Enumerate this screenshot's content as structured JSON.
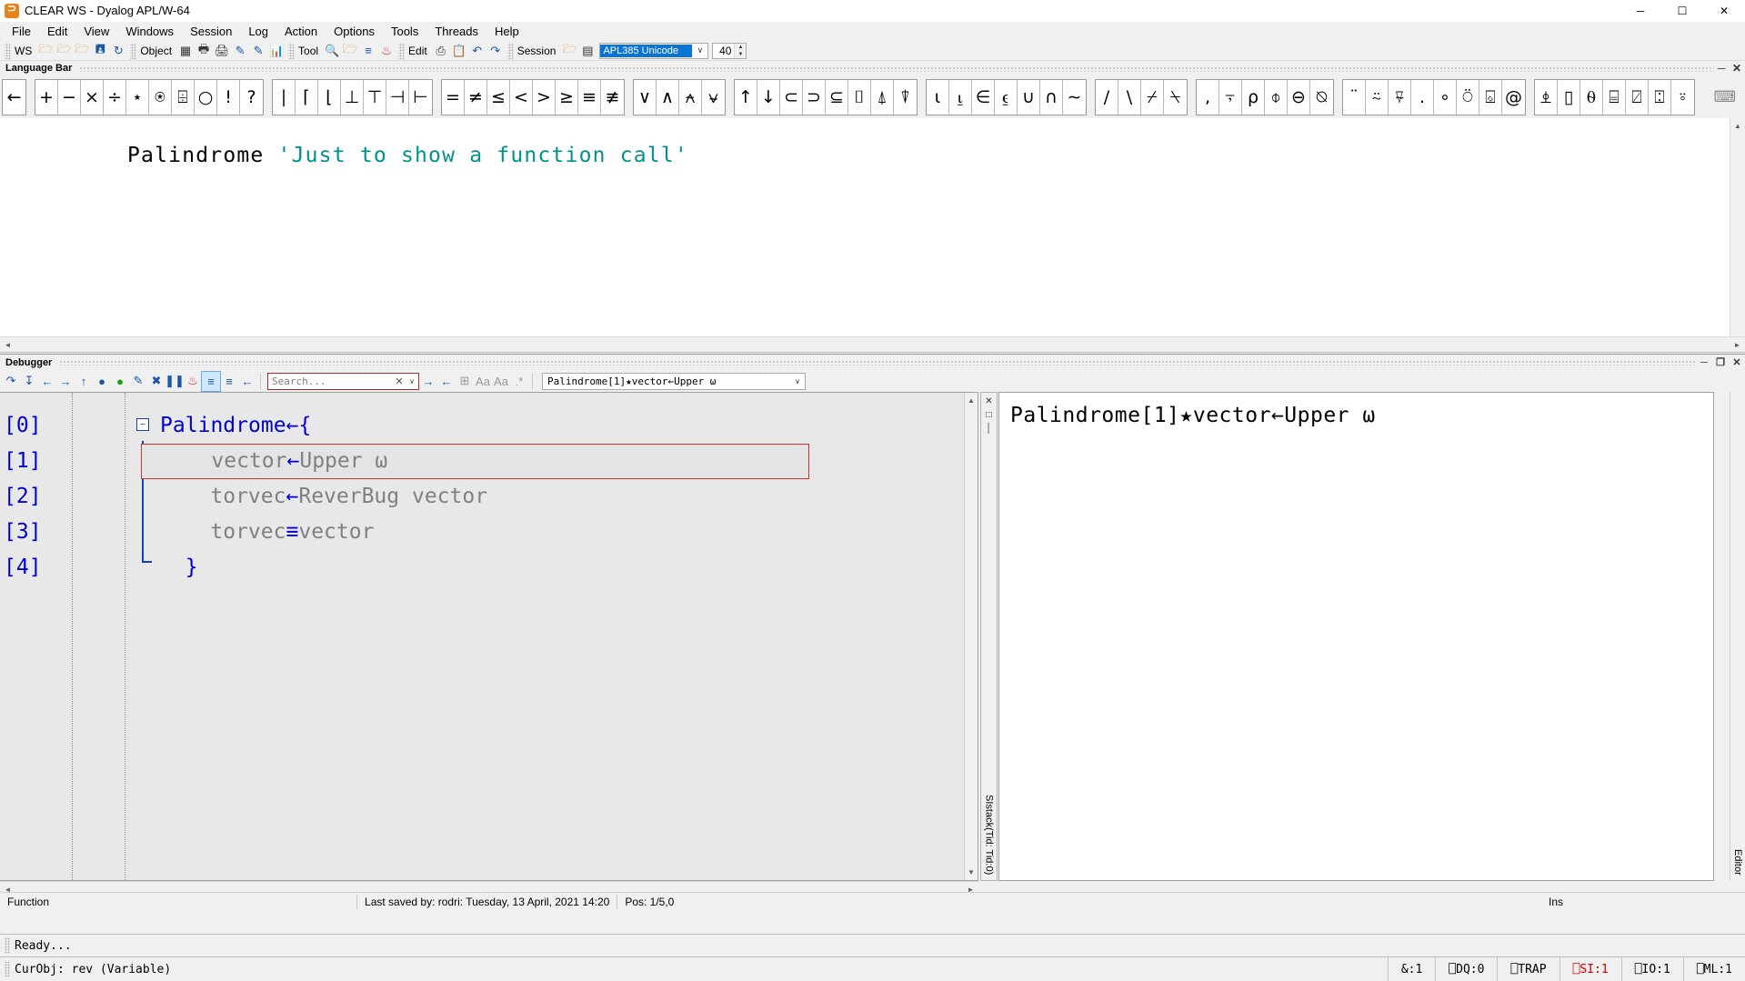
{
  "window": {
    "title": "CLEAR WS - Dyalog APL/W-64",
    "app_icon": "dyalog-logo-icon",
    "minimize": "─",
    "maximize": "☐",
    "close": "✕"
  },
  "menubar": {
    "items": [
      {
        "label": "File"
      },
      {
        "label": "Edit"
      },
      {
        "label": "View"
      },
      {
        "label": "Windows"
      },
      {
        "label": "Session"
      },
      {
        "label": "Log"
      },
      {
        "label": "Action"
      },
      {
        "label": "Options"
      },
      {
        "label": "Tools"
      },
      {
        "label": "Threads"
      },
      {
        "label": "Help"
      }
    ]
  },
  "toolbar": {
    "ws_label": "WS",
    "ws_icons": [
      "new-ws-icon",
      "open-ws-icon",
      "copy-ws-icon",
      "save-ws-icon",
      "refresh-ws-icon"
    ],
    "object_label": "Object",
    "object_icons": [
      "grid-icon",
      "print-preview-icon",
      "print-icon",
      "edit-object-icon",
      "new-object-icon",
      "chart-icon"
    ],
    "tool_label": "Tool",
    "tool_icons": [
      "search-icon",
      "explorer-icon",
      "list-icon",
      "user-command-icon"
    ],
    "edit_label": "Edit",
    "edit_icons": [
      "copy-icon",
      "paste-icon",
      "undo-icon",
      "redo-icon"
    ],
    "session_label": "Session",
    "session_icons": [
      "folder-icon",
      "line-numbers-icon"
    ],
    "font_name": "APL385 Unicode",
    "font_size": "40",
    "dropdown_arrow": "∨"
  },
  "language_bar": {
    "title": "Language Bar",
    "minimize_icon": "─",
    "close_icon": "✕",
    "keyboard_icon": "keyboard-icon",
    "groups": [
      {
        "keys": [
          "←"
        ]
      },
      {
        "keys": [
          "+",
          "−",
          "×",
          "÷",
          "⋆",
          "⍟",
          "⌹",
          "○",
          "!",
          "?"
        ]
      },
      {
        "keys": [
          "∣",
          "⌈",
          "⌊",
          "⊥",
          "⊤",
          "⊣",
          "⊢"
        ]
      },
      {
        "keys": [
          "=",
          "≠",
          "≤",
          "<",
          ">",
          "≥",
          "≡",
          "≢"
        ]
      },
      {
        "keys": [
          "∨",
          "∧",
          "⍲",
          "⍱"
        ]
      },
      {
        "keys": [
          "↑",
          "↓",
          "⊂",
          "⊃",
          "⊆",
          "⌷",
          "⍋",
          "⍒"
        ]
      },
      {
        "keys": [
          "⍳",
          "⍸",
          "∈",
          "⍷",
          "∪",
          "∩",
          "∼"
        ]
      },
      {
        "keys": [
          "/",
          "\\",
          "⌿",
          "⍀"
        ]
      },
      {
        "keys": [
          ",",
          "⍪",
          "⍴",
          "⌽",
          "⊖",
          "⍉"
        ]
      },
      {
        "keys": [
          "¨",
          "⍨",
          "⍫",
          ".",
          "∘",
          "⍥",
          "⌺",
          "@"
        ]
      },
      {
        "keys": [
          "⍎",
          "▯",
          "⍬",
          "⌸",
          "⍁",
          "⍠",
          "⍤"
        ]
      }
    ]
  },
  "session": {
    "function_call": "Palindrome ",
    "string_arg": "'Just to show a function call'",
    "scroll_up": "▲",
    "scroll_down": "▼",
    "scroll_left": "◄",
    "scroll_right": "►"
  },
  "debugger": {
    "title": "Debugger",
    "minimize_icon": "─",
    "restore_icon": "❐",
    "close_icon": "✕",
    "toolbar_icons": [
      "step-into-icon",
      "step-over-icon",
      "back-icon",
      "forward-icon",
      "step-out-icon",
      "run-to-cursor-icon",
      "continue-icon",
      "clear-trace-icon",
      "stop-icon",
      "pause-icon",
      "clear-breakpoints-icon",
      "line-numbers-icon",
      "outline-icon",
      "return-icon"
    ],
    "search": {
      "placeholder": "Search...",
      "clear_icon": "✕",
      "dropdown_icon": "∨"
    },
    "find_icons": [
      "find-next-icon",
      "find-prev-icon",
      "expand-icon",
      "match-case-icon",
      "whole-word-icon",
      "regex-icon"
    ],
    "match_case_label": "Aa",
    "whole_word_label": "Aa",
    "regex_label": ".*",
    "stack_combo_value": "Palindrome[1]★vector←Upper ω",
    "stack_dropdown_icon": "∨",
    "sistack_label": "SIstack(Tid: Tid:0)",
    "editor_tab_label": "Editor",
    "code": {
      "line_numbers": [
        "[0]",
        "[1]",
        "[2]",
        "[3]",
        "[4]"
      ],
      "fold_icon": "−",
      "lines": [
        {
          "text": "Palindrome←{",
          "highlighted": false
        },
        {
          "text": "    vector←Upper ω",
          "highlighted": true
        },
        {
          "text": "    torvec←ReverBug vector",
          "highlighted": false
        },
        {
          "text": "    torvec≡vector",
          "highlighted": false
        },
        {
          "text": "  }",
          "highlighted": false
        }
      ]
    },
    "trace_line": "Palindrome[1]★vector←Upper ω",
    "status": {
      "type": "Function",
      "last_saved": "Last saved by: rodri: Tuesday, 13 April, 2021 14:20",
      "position": "Pos: 1/5,0",
      "insert_mode": "Ins"
    }
  },
  "status_bars": {
    "ready_text": "Ready...",
    "curobj_text": "CurObj: rev (Variable)",
    "indicators": [
      {
        "label": "&:1",
        "highlight": false
      },
      {
        "label": "⎕DQ:0",
        "highlight": false
      },
      {
        "label": "⎕TRAP",
        "highlight": false
      },
      {
        "label": "⎕SI:1",
        "highlight": true
      },
      {
        "label": "⎕IO:1",
        "highlight": false
      },
      {
        "label": "⎕ML:1",
        "highlight": false
      }
    ]
  },
  "colors": {
    "accent_blue": "#0000d0",
    "string_teal": "#00918f",
    "highlight_red": "#d03030",
    "select_blue": "#0a74d4"
  }
}
